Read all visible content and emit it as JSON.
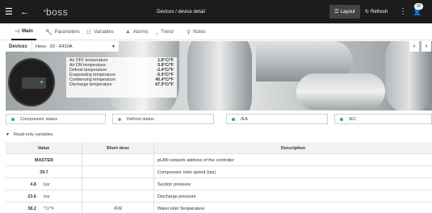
{
  "topbar": {
    "logo": "boss",
    "title": "Devices / device detail",
    "layout_label": "Layout",
    "refresh_label": "Refresh",
    "notification_count": "10"
  },
  "tabs": [
    {
      "label": "Main",
      "icon": "thermostat-icon",
      "active": true
    },
    {
      "label": "Parameters",
      "icon": "wrench-icon"
    },
    {
      "label": "Variables",
      "icon": "list-icon"
    },
    {
      "label": "Alarms",
      "icon": "bell-icon"
    },
    {
      "label": "Trend",
      "icon": "chart-icon"
    },
    {
      "label": "Notes",
      "icon": "pin-icon"
    }
  ],
  "device_bar": {
    "label": "Devices",
    "selected": "Heos - 20 - R410A"
  },
  "temperatures": [
    {
      "name": "Air OFF temperature",
      "value": "1.8°C/°F"
    },
    {
      "name": "Air ON temperature",
      "value": "5.8°C/°F"
    },
    {
      "name": "Defrost temperature",
      "value": "-2.4°C/°F"
    },
    {
      "name": "Evaporating temperature",
      "value": "-5.9°C/°F"
    },
    {
      "name": "Condensing temperature",
      "value": "40.4°C/°F"
    },
    {
      "name": "Discharge temperature",
      "value": "67.9°C/°F"
    }
  ],
  "statuses": [
    {
      "label": "Compressor status",
      "color": "#3cb043"
    },
    {
      "label": "Defrost status",
      "color": "#9a9a9a"
    },
    {
      "label": "/EA",
      "color": "#3cb043"
    },
    {
      "label": "/EC",
      "color": "#3cb043"
    }
  ],
  "readonly_label": "Read-only variables",
  "table": {
    "headers": {
      "value": "Value",
      "short": "Short desc",
      "desc": "Description"
    },
    "rows": [
      {
        "value": "MASTER",
        "unit": "",
        "short": "",
        "desc": "pLAN network address of the controller"
      },
      {
        "value": "39.7",
        "unit": "",
        "short": "",
        "desc": "Compressor rotor speed (rps)"
      },
      {
        "value": "4.8",
        "unit": "bar",
        "short": "",
        "desc": "Suction pressure"
      },
      {
        "value": "23.6",
        "unit": "bar",
        "short": "",
        "desc": "Discharge pressure"
      },
      {
        "value": "38.2",
        "unit": "°C/°F",
        "short": "/FW",
        "desc": "Water inlet Temperature"
      }
    ]
  }
}
